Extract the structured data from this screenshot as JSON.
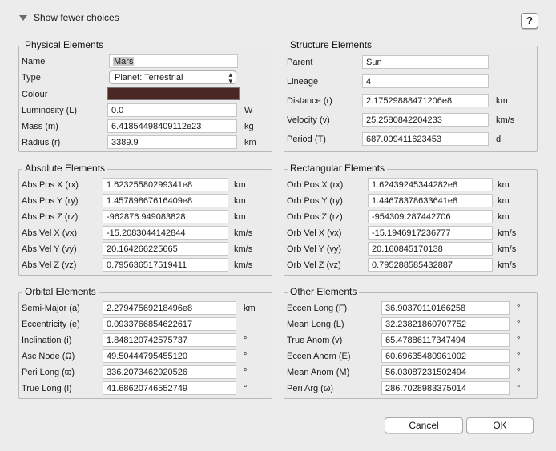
{
  "toggle": {
    "label": "Show fewer choices"
  },
  "help_label": "?",
  "physical": {
    "title": "Physical Elements",
    "name": {
      "label": "Name",
      "value": "Mars"
    },
    "type": {
      "label": "Type",
      "value": "Planet: Terrestrial"
    },
    "colour": {
      "label": "Colour",
      "value": "#4a2723"
    },
    "luminosity": {
      "label": "Luminosity (L)",
      "value": "0.0",
      "unit": "W"
    },
    "mass": {
      "label": "Mass (m)",
      "value": "6.41854498409112e23",
      "unit": "kg"
    },
    "radius": {
      "label": "Radius (r)",
      "value": "3389.9",
      "unit": "km"
    }
  },
  "structure": {
    "title": "Structure Elements",
    "rows": [
      {
        "label": "Parent",
        "value": "Sun",
        "unit": ""
      },
      {
        "label": "Lineage",
        "value": "4",
        "unit": ""
      },
      {
        "label": "Distance (r)",
        "value": "2.17529888471206e8",
        "unit": "km"
      },
      {
        "label": "Velocity (v)",
        "value": "25.2580842204233",
        "unit": "km/s"
      },
      {
        "label": "Period (T)",
        "value": "687.009411623453",
        "unit": "d"
      }
    ]
  },
  "absolute": {
    "title": "Absolute Elements",
    "rows": [
      {
        "label": "Abs Pos X (rx)",
        "value": "1.62325580299341e8",
        "unit": "km"
      },
      {
        "label": "Abs Pos Y (ry)",
        "value": "1.45789867616409e8",
        "unit": "km"
      },
      {
        "label": "Abs Pos Z (rz)",
        "value": "-962876.949083828",
        "unit": "km"
      },
      {
        "label": "Abs Vel X (vx)",
        "value": "-15.2083044142844",
        "unit": "km/s"
      },
      {
        "label": "Abs Vel Y (vy)",
        "value": "20.164266225665",
        "unit": "km/s"
      },
      {
        "label": "Abs Vel Z (vz)",
        "value": "0.795636517519411",
        "unit": "km/s"
      }
    ]
  },
  "rectangular": {
    "title": "Rectangular Elements",
    "rows": [
      {
        "label": "Orb Pos X (rx)",
        "value": "1.62439245344282e8",
        "unit": "km"
      },
      {
        "label": "Orb Pos Y (ry)",
        "value": "1.44678378633641e8",
        "unit": "km"
      },
      {
        "label": "Orb Pos Z (rz)",
        "value": "-954309.287442706",
        "unit": "km"
      },
      {
        "label": "Orb Vel X (vx)",
        "value": "-15.1946917236777",
        "unit": "km/s"
      },
      {
        "label": "Orb Vel Y (vy)",
        "value": "20.160845170138",
        "unit": "km/s"
      },
      {
        "label": "Orb Vel Z (vz)",
        "value": "0.795288585432887",
        "unit": "km/s"
      }
    ]
  },
  "orbital": {
    "title": "Orbital Elements",
    "rows": [
      {
        "label": "Semi-Major (a)",
        "value": "2.27947569218496e8",
        "unit": "km"
      },
      {
        "label": "Eccentricity (e)",
        "value": "0.0933766854622617",
        "unit": ""
      },
      {
        "label": "Inclination (i)",
        "value": "1.848120742575737",
        "unit": "°"
      },
      {
        "label": "Asc Node (Ω)",
        "value": "49.50444795455120",
        "unit": "°"
      },
      {
        "label": "Peri Long (ϖ)",
        "value": "336.2073462920526",
        "unit": "°"
      },
      {
        "label": "True Long (l)",
        "value": "41.68620746552749",
        "unit": "°"
      }
    ]
  },
  "other": {
    "title": "Other Elements",
    "rows": [
      {
        "label": "Eccen Long (F)",
        "value": "36.90370110166258",
        "unit": "°"
      },
      {
        "label": "Mean Long (L)",
        "value": "32.23821860707752",
        "unit": "°"
      },
      {
        "label": "True Anom (v)",
        "value": "65.47886117347494",
        "unit": "°"
      },
      {
        "label": "Eccen Anom (E)",
        "value": "60.69635480961002",
        "unit": "°"
      },
      {
        "label": "Mean Anom (M)",
        "value": "56.03087231502494",
        "unit": "°"
      },
      {
        "label": "Peri Arg (ω)",
        "value": "286.7028983375014",
        "unit": "°"
      }
    ]
  },
  "buttons": {
    "cancel": "Cancel",
    "ok": "OK"
  }
}
